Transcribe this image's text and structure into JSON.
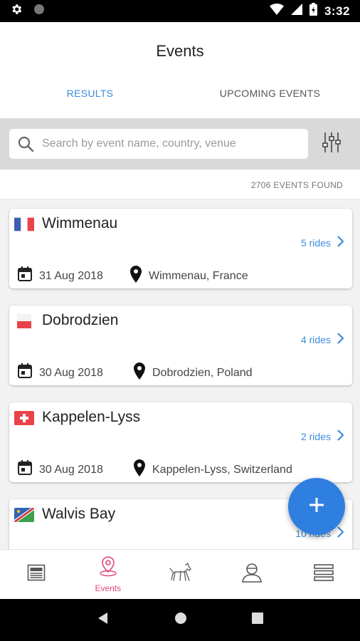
{
  "status_bar": {
    "time": "3:32"
  },
  "header": {
    "title": "Events"
  },
  "tabs": [
    {
      "label": "RESULTS",
      "active": true
    },
    {
      "label": "UPCOMING EVENTS",
      "active": false
    }
  ],
  "search": {
    "placeholder": "Search by event name, country, venue",
    "value": ""
  },
  "results": {
    "count_text": "2706 EVENTS FOUND"
  },
  "events": [
    {
      "name": "Wimmenau",
      "country_flag": "france",
      "rides": "5 rides",
      "date": "31 Aug 2018",
      "location": "Wimmenau, France"
    },
    {
      "name": "Dobrodzien",
      "country_flag": "poland",
      "rides": "4 rides",
      "date": "30 Aug 2018",
      "location": "Dobrodzien, Poland"
    },
    {
      "name": "Kappelen-Lyss",
      "country_flag": "switzerland",
      "rides": "2 rides",
      "date": "30 Aug 2018",
      "location": "Kappelen-Lyss, Switzerland"
    },
    {
      "name": "Walvis Bay",
      "country_flag": "namibia",
      "rides": "10 rides",
      "date": "",
      "location": ""
    }
  ],
  "bottom_nav": [
    {
      "icon": "news-icon",
      "label": ""
    },
    {
      "icon": "location-pin-icon",
      "label": "Events",
      "active": true
    },
    {
      "icon": "horse-icon",
      "label": ""
    },
    {
      "icon": "profile-icon",
      "label": ""
    },
    {
      "icon": "menu-icon",
      "label": ""
    }
  ],
  "colors": {
    "accent": "#3a8ddc",
    "fab": "#2f7fe0",
    "active_nav": "#e0447a"
  }
}
